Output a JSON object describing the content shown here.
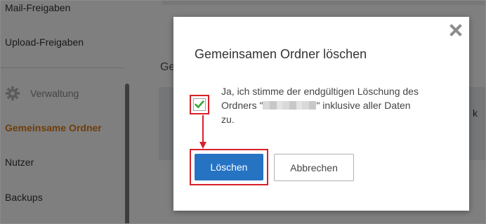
{
  "sidebar": {
    "items": {
      "mail_shares": "Mail-Freigaben",
      "upload_shares": "Upload-Freigaben",
      "admin_section": "Verwaltung",
      "shared_folders": "Gemeinsame Ordner",
      "users": "Nutzer",
      "backups": "Backups"
    },
    "active_color": "#e07a14"
  },
  "main": {
    "heading_fragment": "Ge",
    "panel_text_fragment": "k"
  },
  "dialog": {
    "title": "Gemeinsamen Ordner löschen",
    "confirm_checked": true,
    "confirm_text_before": "Ja, ich stimme der endgültigen Löschung des Ordners \"",
    "confirm_text_after": "\" inklusive aller Daten zu.",
    "delete_label": "Löschen",
    "cancel_label": "Abbrechen",
    "primary_color": "#2673c4",
    "highlight_color": "#d8202a",
    "check_color": "#3aa63a"
  }
}
